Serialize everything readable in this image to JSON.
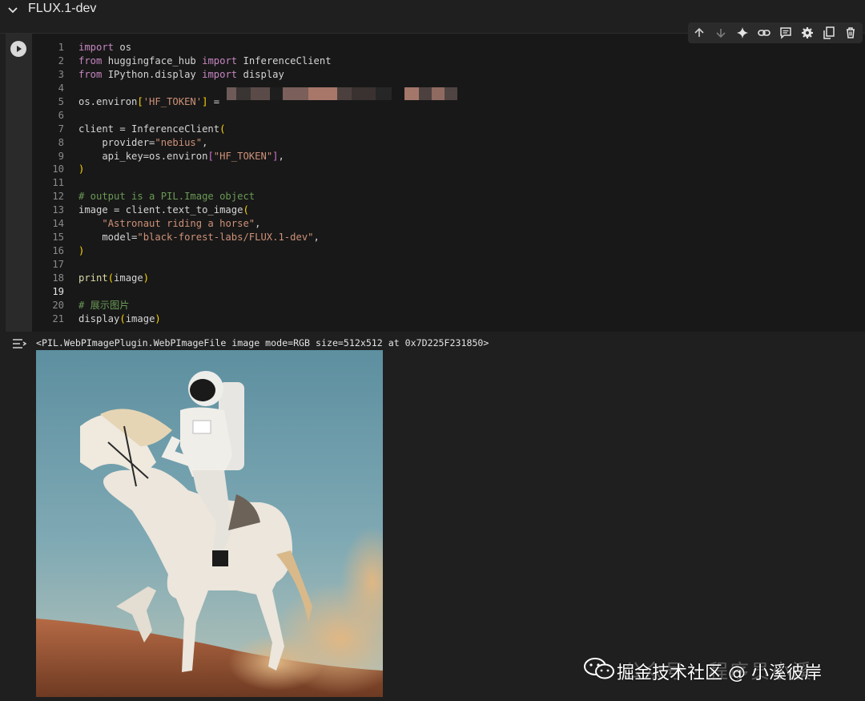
{
  "section": {
    "title": "FLUX.1-dev"
  },
  "toolbar": {
    "icons": [
      "arrow-up-icon",
      "arrow-down-icon",
      "sparkle-icon",
      "link-icon",
      "comment-icon",
      "gear-icon",
      "mirror-cell-icon",
      "trash-icon"
    ]
  },
  "code_cell": {
    "lines": [
      {
        "n": "1",
        "text": "import os"
      },
      {
        "n": "2",
        "text": "from huggingface_hub import InferenceClient"
      },
      {
        "n": "3",
        "text": "from IPython.display import display"
      },
      {
        "n": "4",
        "text": ""
      },
      {
        "n": "5",
        "text": "os.environ['HF_TOKEN'] = "
      },
      {
        "n": "6",
        "text": ""
      },
      {
        "n": "7",
        "text": "client = InferenceClient("
      },
      {
        "n": "8",
        "text": "    provider=\"nebius\","
      },
      {
        "n": "9",
        "text": "    api_key=os.environ[\"HF_TOKEN\"],"
      },
      {
        "n": "10",
        "text": ")"
      },
      {
        "n": "11",
        "text": ""
      },
      {
        "n": "12",
        "text": "# output is a PIL.Image object"
      },
      {
        "n": "13",
        "text": "image = client.text_to_image("
      },
      {
        "n": "14",
        "text": "    \"Astronaut riding a horse\","
      },
      {
        "n": "15",
        "text": "    model=\"black-forest-labs/FLUX.1-dev\","
      },
      {
        "n": "16",
        "text": ")"
      },
      {
        "n": "17",
        "text": ""
      },
      {
        "n": "18",
        "text": "print(image)"
      },
      {
        "n": "19",
        "text": ""
      },
      {
        "n": "20",
        "text": "# 展示图片"
      },
      {
        "n": "21",
        "text": "display(image)"
      }
    ]
  },
  "output": {
    "text": "<PIL.WebPImagePlugin.WebPImageFile image mode=RGB size=512x512 at 0x7D225F231850>"
  },
  "watermark": {
    "main": "掘金技术社区 @ 小溪彼岸",
    "faint": "公众号 · 程序员小溪"
  },
  "colors": {
    "background": "#1f1f1f",
    "editor": "#181818",
    "keyword": "#c586c0",
    "string": "#ce9178",
    "comment": "#6a9955"
  }
}
